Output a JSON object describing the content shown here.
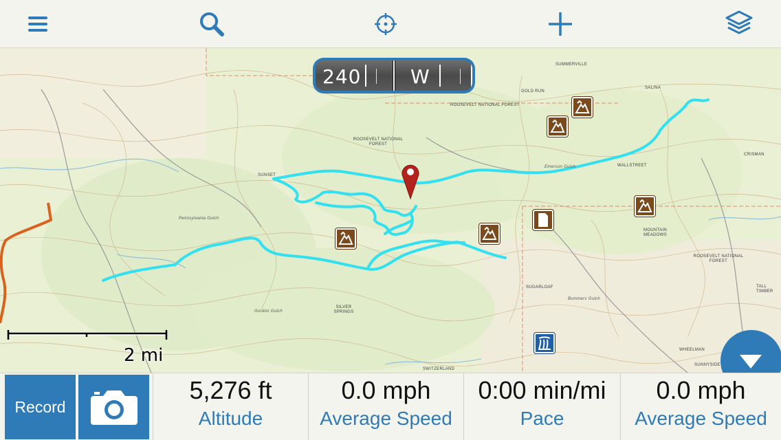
{
  "toolbar": {
    "icons": [
      "menu-icon",
      "search-icon",
      "locate-icon",
      "add-icon",
      "layers-icon"
    ]
  },
  "compass": {
    "heading_value": "240",
    "cardinal": "W"
  },
  "map": {
    "labels": {
      "summerville": "Summerville",
      "salina": "Salina",
      "roosevelt_nf_top": "ROOSEVELT NATIONAL FOREST",
      "roosevelt_nf_mid": "ROOSEVELT NATIONAL FOREST",
      "roosevelt_nf_right": "ROOSEVELT NATIONAL FOREST",
      "gold_run": "Gold Run",
      "wallstreet": "Wallstreet",
      "crisman": "Crisman",
      "sunset": "Sunset",
      "mountain_meadows": "Mountain Meadows",
      "silver_springs": "Silver Springs",
      "sugarloaf": "Sugarloaf",
      "wheelman": "Wheelman",
      "sunnyside": "Sunnyside",
      "switzerland": "Switzerland",
      "gordon_gulch": "Gordon Gulch",
      "tall_timber": "Tall Timber",
      "emerson_gulch": "Emerson Gulch",
      "bummers_gulch": "Bummers Gulch",
      "pennsylvania_gulch": "Pennsylvania Gulch"
    },
    "scale_label": "2 mi",
    "track_color": "#33e0f0",
    "pin_color": "#b3221b",
    "road_color": "#d9621f"
  },
  "stats_bar": {
    "record_label": "Record",
    "camera_icon": "camera-icon",
    "stats": [
      {
        "value": "5,276 ft",
        "label": "Altitude"
      },
      {
        "value": "0.0 mph",
        "label": "Average Speed"
      },
      {
        "value": "0:00 min/mi",
        "label": "Pace"
      },
      {
        "value": "0.0 mph",
        "label": "Average Speed"
      }
    ]
  },
  "colors": {
    "accent": "#2e7bb8",
    "toolbar_bg": "#f4f4ef",
    "map_bg": "#eef0d8",
    "poi_brown": "#7a4a1c"
  }
}
